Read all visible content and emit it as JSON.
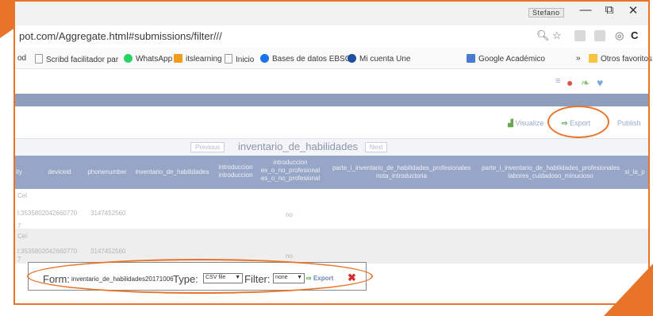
{
  "window": {
    "user_badge": "Stefano",
    "minimize": "—",
    "maximize": "⧉",
    "close": "✕"
  },
  "address": {
    "url": "pot.com/Aggregate.html#submissions/filter///",
    "zoom_icon": "magnifier-icon",
    "star_icon": "star-icon"
  },
  "bookmarks": {
    "items": [
      {
        "label": "od",
        "color": "#ffffff"
      },
      {
        "label": "Scribd facilitador par",
        "color": "#ffffff"
      },
      {
        "label": "WhatsApp",
        "color": "#25d366"
      },
      {
        "label": "itslearning",
        "color": "#f29b1d"
      },
      {
        "label": "Inicio",
        "color": "#ffffff"
      },
      {
        "label": "Bases de datos EBSC",
        "color": "#1a73e8"
      },
      {
        "label": "Mi cuenta Une",
        "color": "#1e4fa3"
      },
      {
        "label": "Google Académico",
        "color": "#4a7bd0"
      }
    ],
    "more": "»",
    "other": "Otros favoritos"
  },
  "actions": {
    "visualize": "Visualize",
    "export": "Export",
    "publish": "Publish"
  },
  "form_nav": {
    "previous": "Previous",
    "title": "inventario_de_habilidades",
    "next": "Next"
  },
  "table": {
    "headers": [
      "ity",
      "deviceid",
      "phonenumber",
      "inventario_de_habilidades",
      "introduccion\nintroduccion",
      "introduccion\nes_o_no_profesional\nes_o_no_profesional",
      "parte_i_inventario_de_habilidades_profesionales\nnota_introductoria",
      "parte_i_inventario_de_habilidades_profesionales\nlabores_cuidadoso_minucioso",
      "si_la_p"
    ],
    "rows": [
      {
        "c0": "Cel",
        "deviceid": "l:3535802042660770",
        "phone": "3147452560",
        "value": "no",
        "marker": "7"
      },
      {
        "c0": "Cel",
        "deviceid": "l:3535802042660770",
        "phone": "3147452560",
        "value": "no",
        "marker": "7"
      }
    ]
  },
  "dialog": {
    "form_label": "Form:",
    "form_value": "inventario_de_habilidades20171006",
    "type_label": "Type:",
    "type_value": "CSV file",
    "filter_label": "Filter:",
    "filter_value": "none",
    "export": "Export",
    "close_icon": "close-x-icon"
  },
  "colors": {
    "annotation": "#e8742a",
    "nav_strip": "#8e9dbb",
    "header": "#97a5c6"
  }
}
